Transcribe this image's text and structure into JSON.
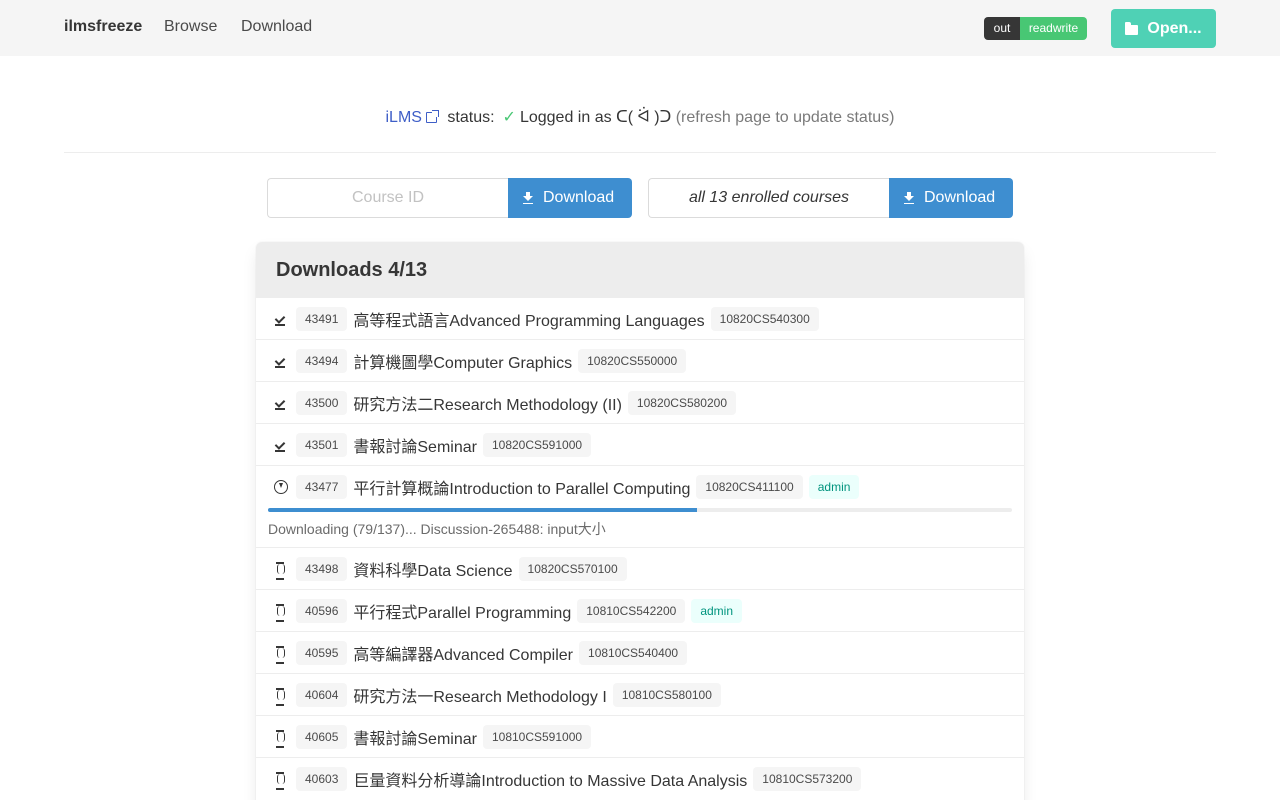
{
  "navbar": {
    "brand": "ilmsfreeze",
    "links": [
      "Browse",
      "Download"
    ],
    "mode_out": "out",
    "mode_rw": "readwrite",
    "open_label": "Open..."
  },
  "status": {
    "ilms": "iLMS",
    "label": "status:",
    "logged_in": "Logged in as ᑕ( ᐛ )ᑐ",
    "hint": "(refresh page to update status)"
  },
  "course_input": {
    "placeholder": "Course ID",
    "download_label": "Download"
  },
  "all_courses": {
    "value": "all 13 enrolled courses",
    "download_label": "Download"
  },
  "downloads": {
    "heading": "Downloads 4/13",
    "done": [
      {
        "id": "43491",
        "name": "高等程式語言Advanced Programming Languages",
        "code": "10820CS540300"
      },
      {
        "id": "43494",
        "name": "計算機圖學Computer Graphics",
        "code": "10820CS550000"
      },
      {
        "id": "43500",
        "name": "研究方法二Research Methodology (II)",
        "code": "10820CS580200"
      },
      {
        "id": "43501",
        "name": "書報討論Seminar",
        "code": "10820CS591000"
      }
    ],
    "active": {
      "id": "43477",
      "name": "平行計算概論Introduction to Parallel Computing",
      "code": "10820CS411100",
      "badge": "admin",
      "progress": 0.577,
      "status_text": "Downloading (79/137)... Discussion-265488: input大小"
    },
    "pending": [
      {
        "id": "43498",
        "name": "資料科學Data Science",
        "code": "10820CS570100"
      },
      {
        "id": "40596",
        "name": "平行程式Parallel Programming",
        "code": "10810CS542200",
        "badge": "admin"
      },
      {
        "id": "40595",
        "name": "高等編譯器Advanced Compiler",
        "code": "10810CS540400"
      },
      {
        "id": "40604",
        "name": "研究方法一Research Methodology I",
        "code": "10810CS580100"
      },
      {
        "id": "40605",
        "name": "書報討論Seminar",
        "code": "10810CS591000"
      },
      {
        "id": "40603",
        "name": "巨量資料分析導論Introduction to Massive Data Analysis",
        "code": "10810CS573200"
      }
    ]
  },
  "colors": {
    "primary": "#3e8ed0",
    "success": "#48c774",
    "turquoise": "#4fd1b5",
    "link": "#3e5ec7"
  }
}
